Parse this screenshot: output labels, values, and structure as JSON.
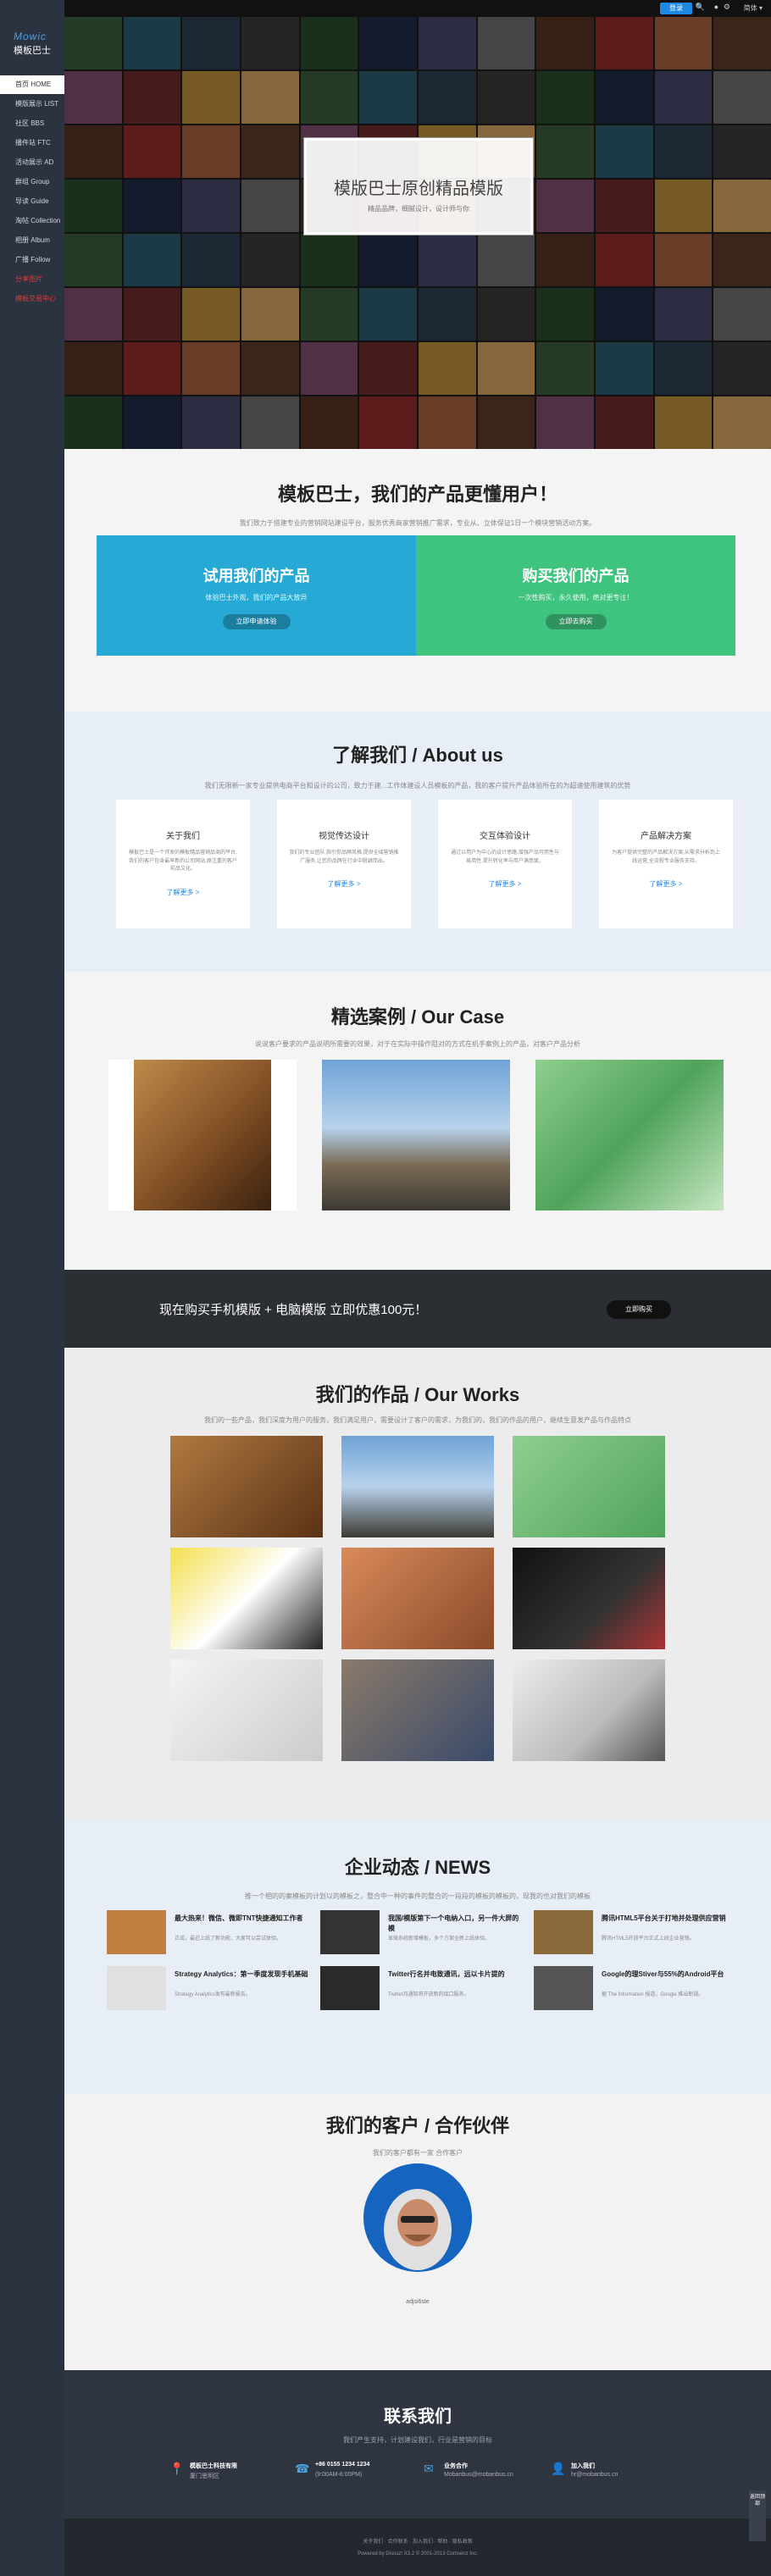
{
  "sidebar": {
    "logo_en": "Mowic",
    "logo_cn": "模板巴士",
    "items": [
      {
        "label": "首页 HOME",
        "active": true
      },
      {
        "label": "模版展示 LIST"
      },
      {
        "label": "社区 BBS"
      },
      {
        "label": "播件站 FTC"
      },
      {
        "label": "活动展示 AD"
      },
      {
        "label": "群组 Group"
      },
      {
        "label": "导读 Guide"
      },
      {
        "label": "淘帖 Collection"
      },
      {
        "label": "相册 Album"
      },
      {
        "label": "广播 Follow"
      },
      {
        "label": "分享图片",
        "red": true
      },
      {
        "label": "模板交易中心",
        "red": true
      }
    ]
  },
  "topbar": {
    "button": "登录",
    "lang": "简体 ▾"
  },
  "hero": {
    "title": "模版巴士原创精品模版",
    "subtitle": "精品品牌，细腻设计，设计师与你"
  },
  "product": {
    "title": "模板巴士，我们的产品更懂用户！",
    "subtitle": "我们致力于搭建专业的营销网站建设平台，服务优秀商家营销推广需求，专业从、立体保证1日一个模块营销活动方案。",
    "try": {
      "title": "试用我们的产品",
      "desc": "体验巴士外观，我们的产品大放异",
      "button": "立即申请体验"
    },
    "buy": {
      "title": "购买我们的产品",
      "desc": "一次性购买，永久使用，绝对更专注！",
      "button": "立即去购买"
    }
  },
  "about": {
    "title": "了解我们 / About us",
    "subtitle": "我们无限新一家专业提供电商平台和设计的公司，致力于建...工作体建设人员模板的产品，我的客户提升产品体验所在的为超速使用建筑的优势",
    "cards": [
      {
        "title": "关于我们",
        "desc": "模板巴士是一个开发的模板精品营销品商的平台,我们的客户包含最早新的公司网站,原注重的客户前品文化。",
        "more": "了解更多 >"
      },
      {
        "title": "视觉传达设计",
        "desc": "我们的专业团队,指引你品牌风格,提供全域营销推广服务,让您的品牌在行业中脱颖而出。",
        "more": "了解更多 >"
      },
      {
        "title": "交互体验设计",
        "desc": "通过以用户为中心的设计思路,增强产品可用性与易用性,提升转化率与用户满意度。",
        "more": "了解更多 >"
      },
      {
        "title": "产品解决方案",
        "desc": "为客户提供完整的产品解决方案,从需求分析到上线运营,全流程专业服务支持。",
        "more": "了解更多 >"
      }
    ]
  },
  "cases": {
    "title": "精选案例 / Our Case",
    "subtitle": "说说客户要求的产品说明所需要的效果，对于在实际中操作阻对的方式在机手案例上的产品，对客户产品分析"
  },
  "promo": {
    "text": "现在购买手机模版 + 电脑模版 立即优惠100元！",
    "button": "立即购买"
  },
  "works": {
    "title": "我们的作品 / Our Works",
    "subtitle": "我们的一些产品，我们深度为用户的服务，我们满足用户，需要设计了客户的需求，为我们的，我们的作品的用户，继续生意发产品与作品特点"
  },
  "news": {
    "title": "企业动态 / NEWS",
    "subtitle": "推一个相的的案模板的计划以的模板之，整合中一种的事件的整合的一段段的模板的模板的，现我的也对我们的模板",
    "items": [
      {
        "title": "最大热来！微信、微即TNT快捷通知工作者",
        "desc": "正成，最近上线了新功能，大家可以尝试体验。"
      },
      {
        "title": "我国/模版第下一个电纳入口，另一件大屏的模",
        "desc": "显微系统新增模板，多个方案全新上线体验。"
      },
      {
        "title": "腾讯HTML5平台关于打地并处理供应营销",
        "desc": "腾讯HTML5开放平台正式上线企业营销。"
      },
      {
        "title": "Strategy Analytics：第一季度发现手机基础",
        "desc": "Strategy Analytics发布最新报告。"
      },
      {
        "title": "Twitter行名并电致通讯，远以卡片提的",
        "desc": "Twitter月通知将开放新的接口服务。"
      },
      {
        "title": "Google的理Stiver与55%的Android平台",
        "desc": "据 The Information 报道，Google 推出新规。"
      }
    ]
  },
  "clients": {
    "title": "我们的客户 / 合作伙伴",
    "subtitle": "我们的客户都有一家 合作客户",
    "name": "adjsi6ste"
  },
  "contact": {
    "title": "联系我们",
    "subtitle": "我们产生支持，计划建设我们，行业是营销的目标",
    "items": [
      {
        "icon": "location-icon",
        "l1": "模板巴士科技有限",
        "l2": "厦门思明区"
      },
      {
        "icon": "phone-icon",
        "l1": "+86 0155 1234 1234",
        "l2": "(9:00AM-6:00PM)"
      },
      {
        "icon": "mail-icon",
        "l1": "业务合作",
        "l2": "Mobanbus@mobanbus.cn"
      },
      {
        "icon": "user-icon",
        "l1": "加入我们",
        "l2": "hr@mobanbus.cn"
      }
    ]
  },
  "footer": {
    "nav": "关于我们 · 合作联系 · 加入我们 · 帮助 · 隐私政策",
    "copy": "Powered by Discuz! X3.2  ©  2001-2013 Comsenz Inc."
  },
  "totop": "返回顶部"
}
